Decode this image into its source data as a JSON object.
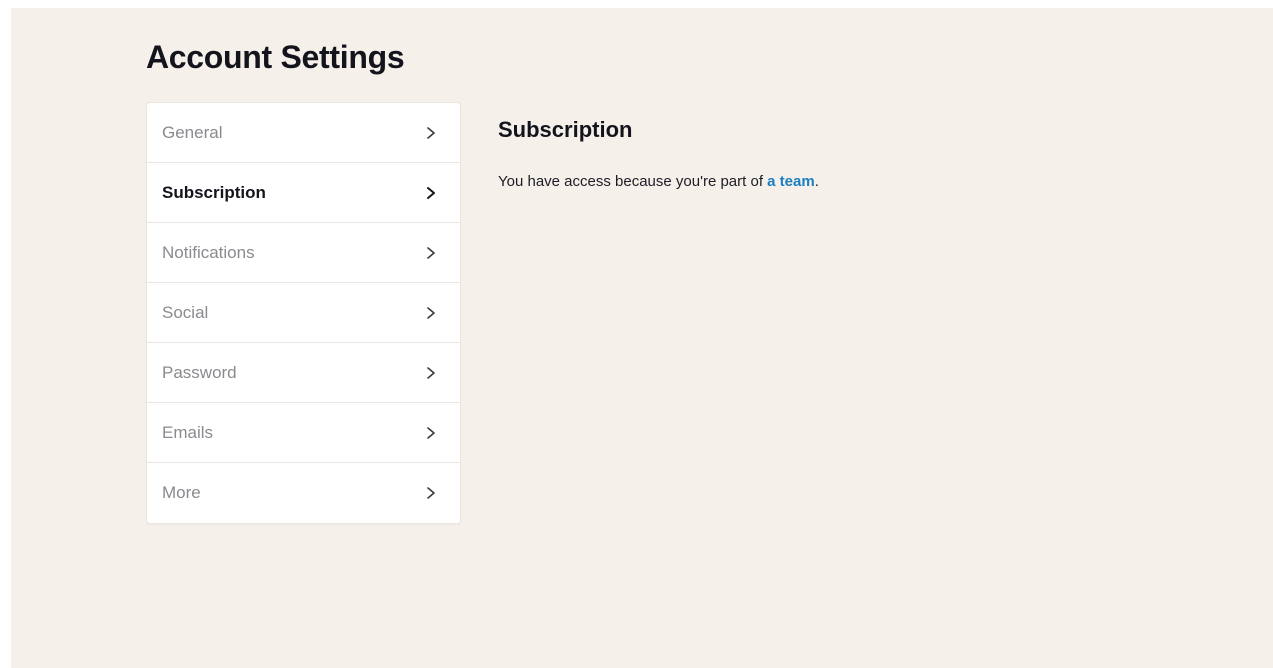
{
  "page": {
    "title": "Account Settings"
  },
  "nav": {
    "items": [
      {
        "label": "General",
        "active": false,
        "icon": "chevron-right-icon"
      },
      {
        "label": "Subscription",
        "active": true,
        "icon": "chevron-right-icon"
      },
      {
        "label": "Notifications",
        "active": false,
        "icon": "chevron-right-icon"
      },
      {
        "label": "Social",
        "active": false,
        "icon": "chevron-right-icon"
      },
      {
        "label": "Password",
        "active": false,
        "icon": "chevron-right-icon"
      },
      {
        "label": "Emails",
        "active": false,
        "icon": "chevron-right-icon"
      },
      {
        "label": "More",
        "active": false,
        "icon": "chevron-right-icon"
      }
    ]
  },
  "content": {
    "title": "Subscription",
    "text_before": "You have access because you're part of ",
    "link_text": "a team",
    "text_after": "."
  },
  "colors": {
    "background": "#f5f0ea",
    "card": "#ffffff",
    "text_primary": "#14141d",
    "text_muted": "#8a8a8f",
    "link": "#1b7ec2"
  }
}
